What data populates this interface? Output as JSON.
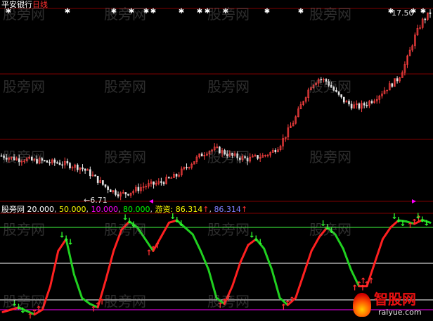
{
  "header": {
    "stock_name": "平安银行",
    "period": "日线",
    "high_price_label": "17.50",
    "low_price_label": "6.71"
  },
  "indicator": {
    "name": "股旁网",
    "params": [
      "20.000",
      "50.000",
      "10.000",
      "80.000"
    ],
    "youzi_label": "游资:",
    "youzi_value": "86.314",
    "value2": "86.314"
  },
  "watermark_text": "股旁网",
  "logo": {
    "cn": "智股网",
    "en": "ralyue.com"
  },
  "colors": {
    "background": "#000000",
    "grid_red": "#800000",
    "candle_up": "#ff4040",
    "candle_down": "#e8e8e8",
    "osc_up": "#ff2020",
    "osc_down": "#20d020",
    "level_green": "#40ff40",
    "level_white": "#ffffff",
    "level_magenta": "#ff00ff",
    "p1": "#ffffff",
    "p2": "#ffff00",
    "p3": "#ff00ff",
    "p4": "#00ff00",
    "youzi": "#ffff00",
    "value2": "#8080ff",
    "arrow_up": "#ff3030",
    "arrow_down": "#30ff30"
  },
  "chart_data": {
    "type": "line",
    "series": [
      {
        "values": [
          9.0,
          8.9,
          8.8,
          8.8,
          8.7,
          8.7,
          8.6,
          8.6,
          8.5,
          8.4,
          8.3,
          8.0,
          7.6,
          7.2,
          6.9,
          6.71,
          6.8,
          7.0,
          7.2,
          7.3,
          7.4,
          7.6,
          7.8,
          8.2,
          8.6,
          9.0,
          9.3,
          9.4,
          9.2,
          9.0,
          8.9,
          8.8,
          8.9,
          9.0,
          9.2,
          9.6,
          10.4,
          11.2,
          12.3,
          13.2,
          13.6,
          13.4,
          12.8,
          12.3,
          12.0,
          11.9,
          12.1,
          12.4,
          12.8,
          13.2,
          13.6,
          14.6,
          16.0,
          17.0,
          17.5
        ]
      },
      {
        "values": [
          8,
          10,
          12,
          9,
          6,
          10,
          30,
          60,
          70,
          40,
          20,
          15,
          12,
          35,
          60,
          78,
          85,
          80,
          70,
          60,
          72,
          84,
          86,
          80,
          74,
          60,
          44,
          20,
          15,
          30,
          50,
          65,
          70,
          62,
          44,
          20,
          14,
          20,
          40,
          60,
          72,
          80,
          74,
          62,
          44,
          30,
          30,
          50,
          70,
          80,
          86,
          85,
          83,
          86.314,
          84
        ]
      }
    ]
  }
}
